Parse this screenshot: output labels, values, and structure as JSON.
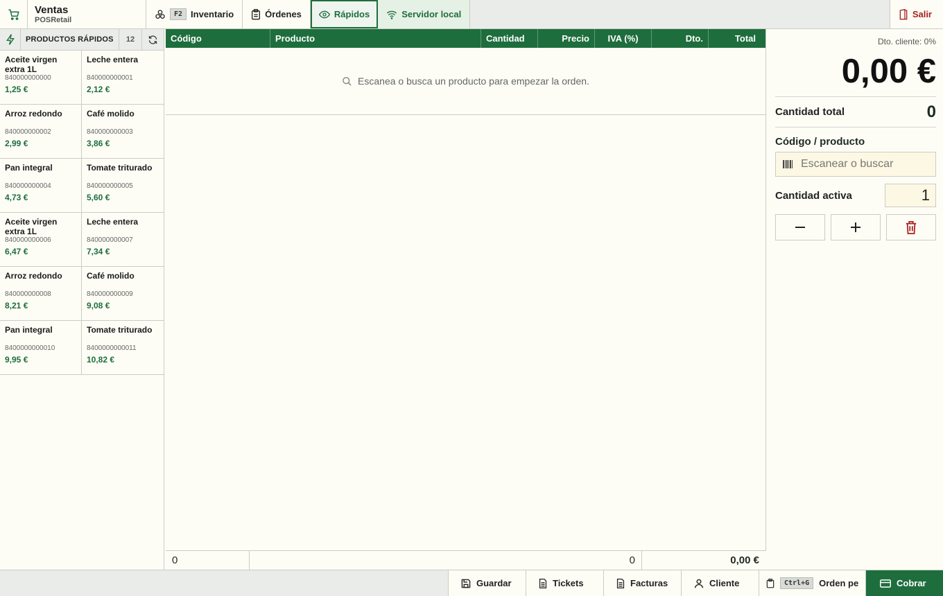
{
  "brand": {
    "title": "Ventas",
    "subtitle": "POSRetail"
  },
  "nav": {
    "inventario_key": "F2",
    "inventario": "Inventario",
    "ordenes": "Órdenes",
    "rapidos": "Rápidos",
    "servidor": "Servidor local",
    "salir": "Salir"
  },
  "quick": {
    "title": "PRODUCTOS RÁPIDOS",
    "count": "12",
    "products": [
      {
        "name": "Aceite virgen extra 1L",
        "code": "840000000000",
        "price": "1,25 €"
      },
      {
        "name": "Leche entera",
        "code": "840000000001",
        "price": "2,12 €"
      },
      {
        "name": "Arroz redondo",
        "code": "840000000002",
        "price": "2,99 €"
      },
      {
        "name": "Café molido",
        "code": "840000000003",
        "price": "3,86 €"
      },
      {
        "name": "Pan integral",
        "code": "840000000004",
        "price": "4,73 €"
      },
      {
        "name": "Tomate triturado",
        "code": "840000000005",
        "price": "5,60 €"
      },
      {
        "name": "Aceite virgen extra 1L",
        "code": "840000000006",
        "price": "6,47 €"
      },
      {
        "name": "Leche entera",
        "code": "840000000007",
        "price": "7,34 €"
      },
      {
        "name": "Arroz redondo",
        "code": "840000000008",
        "price": "8,21 €"
      },
      {
        "name": "Café molido",
        "code": "840000000009",
        "price": "9,08 €"
      },
      {
        "name": "Pan integral",
        "code": "8400000000010",
        "price": "9,95 €"
      },
      {
        "name": "Tomate triturado",
        "code": "8400000000011",
        "price": "10,82 €"
      }
    ]
  },
  "table": {
    "columns": [
      "Código",
      "Producto",
      "Cantidad",
      "Precio",
      "IVA (%)",
      "Dto.",
      "Total"
    ],
    "empty_message": "Escanea o busca un producto para empezar la orden.",
    "footer": {
      "count": "0",
      "qty": "0",
      "total": "0,00 €"
    }
  },
  "summary": {
    "discount": "Dto. cliente: 0%",
    "total": "0,00 €",
    "cantidad_total_label": "Cantidad total",
    "cantidad_total": "0",
    "codigo_label": "Código / producto",
    "search_placeholder": "Escanear o buscar",
    "cantidad_activa_label": "Cantidad activa",
    "cantidad_activa": "1"
  },
  "bottom": {
    "guardar": "Guardar",
    "tickets": "Tickets",
    "facturas": "Facturas",
    "cliente": "Cliente",
    "orden_key": "Ctrl+G",
    "orden": "Orden pe",
    "cobrar": "Cobrar"
  },
  "colors": {
    "accent": "#1e6e3d",
    "danger": "#a82020"
  }
}
